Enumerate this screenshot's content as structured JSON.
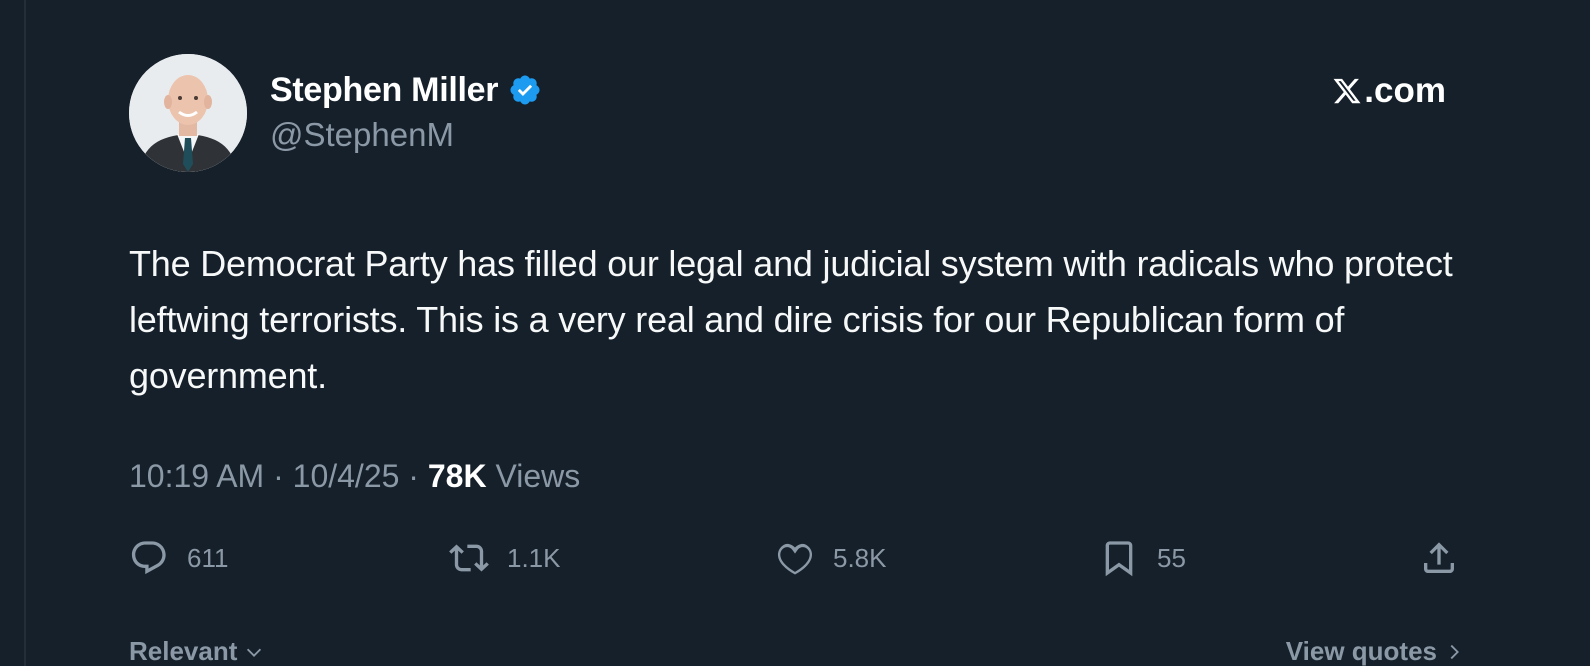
{
  "author": {
    "display_name": "Stephen Miller",
    "handle": "@StephenM",
    "verified": true
  },
  "brand": {
    "label": ".com",
    "icon": "x-logo-icon"
  },
  "tweet": {
    "text": "The Democrat Party has filled our legal and judicial system with radicals who protect leftwing terrorists. This is a very real and dire crisis for our Republican form of government.",
    "time": "10:19 AM",
    "date": "10/4/25",
    "separator": "·",
    "views_count": "78K",
    "views_label": "Views"
  },
  "actions": {
    "reply": {
      "icon": "reply-icon",
      "count": "611"
    },
    "retweet": {
      "icon": "retweet-icon",
      "count": "1.1K"
    },
    "like": {
      "icon": "heart-icon",
      "count": "5.8K"
    },
    "bookmark": {
      "icon": "bookmark-icon",
      "count": "55"
    },
    "share": {
      "icon": "share-icon"
    }
  },
  "footer": {
    "sort_label": "Relevant",
    "view_quotes_label": "View quotes"
  },
  "colors": {
    "background": "#15202b",
    "text_primary": "#f7f9f9",
    "text_secondary": "#8b98a5",
    "verified_blue": "#1d9bf0"
  }
}
